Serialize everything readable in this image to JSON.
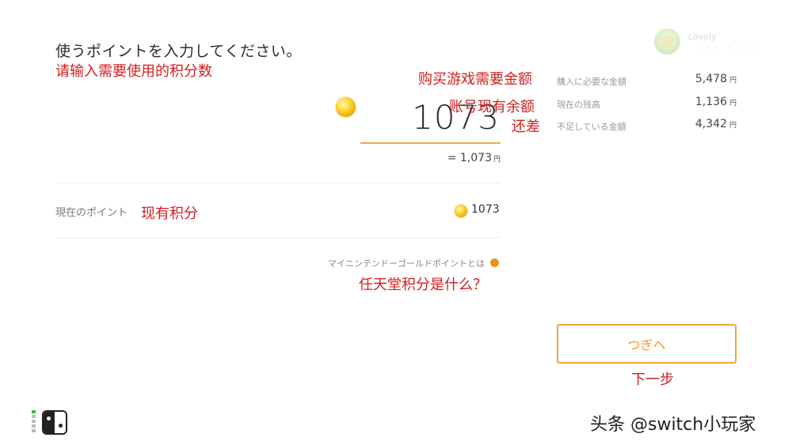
{
  "header": {
    "title": "使うポイントを入力してください。"
  },
  "annotations": {
    "title_zh": "请输入需要使用的积分数",
    "price_zh": "购买游戏需要金额",
    "balance_zh": "账号现有余额",
    "shortfall_zh": "还差",
    "current_points_zh": "现有积分",
    "what_is_zh": "任天堂积分是什么？",
    "next_zh": "下一步"
  },
  "points_input": {
    "value": "1073",
    "yen_equivalent": "= 1,073",
    "yen_unit": "円"
  },
  "current_points": {
    "label": "現在のポイント",
    "value": "1073"
  },
  "info_link": {
    "label": "マイニンテンドーゴールドポイントとは"
  },
  "user": {
    "name": "Lovely",
    "sub": "・・・ ・・・・"
  },
  "summary": [
    {
      "label": "購入に必要な金額",
      "value": "5,478",
      "unit": "円"
    },
    {
      "label": "現在の残高",
      "value": "1,136",
      "unit": "円"
    },
    {
      "label": "不足している金額",
      "value": "4,342",
      "unit": "円"
    }
  ],
  "actions": {
    "next_label": "つぎへ"
  },
  "watermark": {
    "text": "头条 @switch小玩家"
  },
  "colors": {
    "accent": "#f0a43c",
    "annotation": "#d11f1f",
    "coin": "#ffd93a",
    "indicator_green": "#2fbf3a"
  },
  "icons": [
    "gold-coin-icon",
    "info-dot-icon",
    "user-avatar-icon",
    "switch-console-icon",
    "controller-status-icon"
  ]
}
